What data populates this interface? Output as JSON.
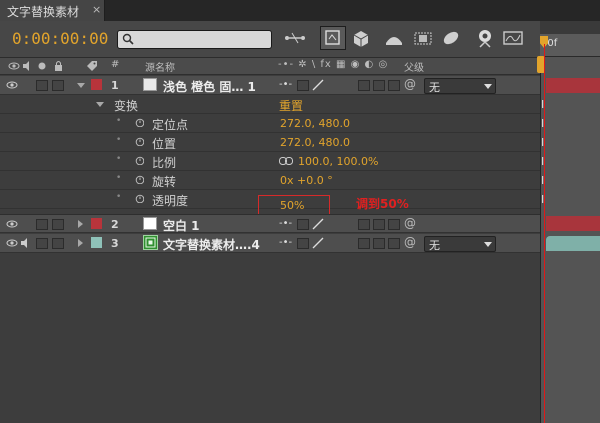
{
  "tab": {
    "title": "文字替换素材",
    "close": "×"
  },
  "toolbar": {
    "timecode": "0:00:00:00",
    "search_placeholder": ""
  },
  "columns": {
    "hash": "#",
    "source_name": "源名称",
    "parent": "父级"
  },
  "timeline": {
    "ruler_label": "00f"
  },
  "layers": [
    {
      "number": "1",
      "name": "浅色 橙色 固… 1",
      "label_color": "#b8343b",
      "parent": "无"
    },
    {
      "number": "2",
      "name": "空白 1",
      "label_color": "#b8343b"
    },
    {
      "number": "3",
      "name": "文字替换素材….4",
      "label_color": "#8fc2b9",
      "parent": "无"
    }
  ],
  "transform": {
    "group_label": "变换",
    "reset_label": "重置",
    "properties": [
      {
        "name": "定位点",
        "value": "272.0, 480.0"
      },
      {
        "name": "位置",
        "value": "272.0, 480.0"
      },
      {
        "name": "比例",
        "value": "100.0, 100.0%"
      },
      {
        "name": "旋转",
        "value": "0x +0.0 °"
      },
      {
        "name": "透明度",
        "value": "50%"
      }
    ]
  },
  "annotation": {
    "text": "调到50%",
    "color": "#e02020"
  },
  "colors": {
    "accent": "#e2a42c",
    "playhead": "#e01818"
  }
}
